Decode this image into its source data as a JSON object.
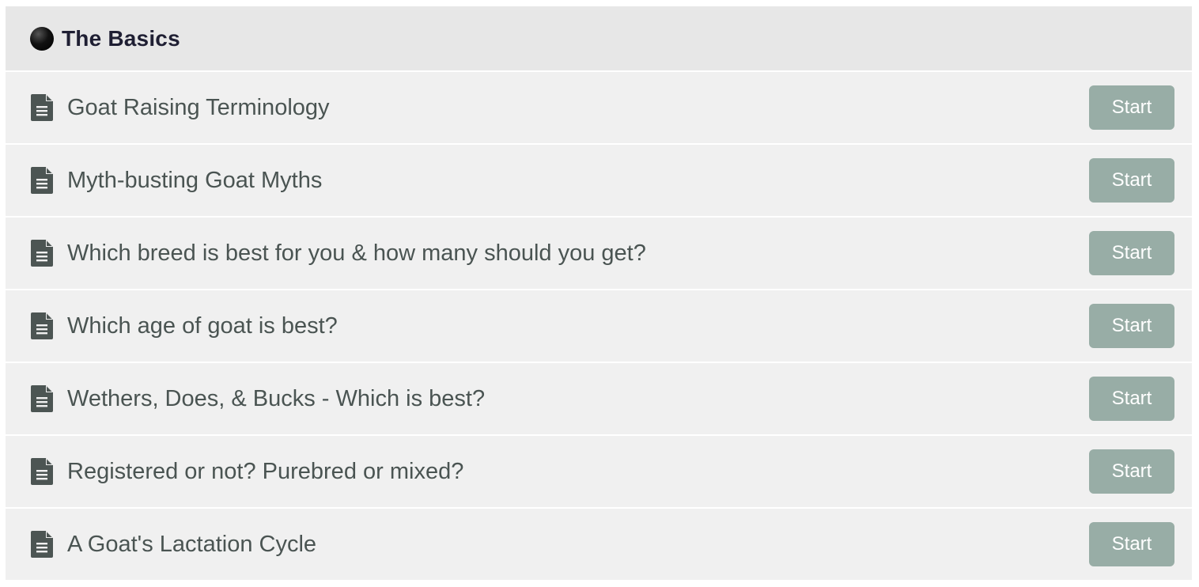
{
  "section": {
    "title": "The Basics",
    "icon": "black-circle-icon"
  },
  "lessons": [
    {
      "title": "Goat Raising Terminology",
      "button": "Start",
      "icon": "document-icon"
    },
    {
      "title": "Myth-busting Goat Myths",
      "button": "Start",
      "icon": "document-icon"
    },
    {
      "title": "Which breed is best for you & how many should you get?",
      "button": "Start",
      "icon": "document-icon"
    },
    {
      "title": "Which age of goat is best?",
      "button": "Start",
      "icon": "document-icon"
    },
    {
      "title": "Wethers, Does, & Bucks - Which is best?",
      "button": "Start",
      "icon": "document-icon"
    },
    {
      "title": "Registered or not? Purebred or mixed?",
      "button": "Start",
      "icon": "document-icon"
    },
    {
      "title": "A Goat's Lactation Cycle",
      "button": "Start",
      "icon": "document-icon"
    }
  ],
  "colors": {
    "header_bg": "#e7e7e7",
    "row_bg": "#f0f0f0",
    "button_bg": "#98ada6",
    "text": "#4a5452",
    "title_text": "#1f1f33"
  }
}
